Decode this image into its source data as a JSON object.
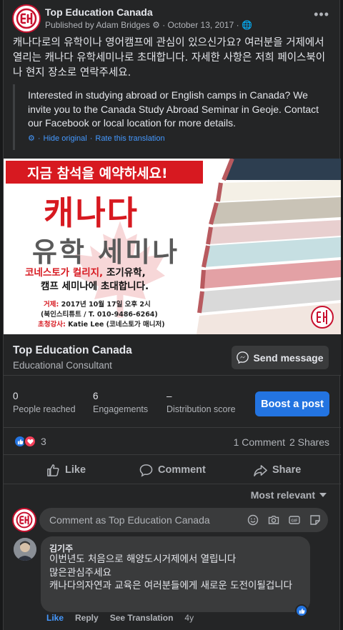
{
  "post": {
    "page_name": "Top Education Canada",
    "published_by": "Published by Adam Bridges",
    "date": "October 13, 2017",
    "more": "•••",
    "body_korean": "캐나다로의 유학이나 영어캠프에 관심이 있으신가요? 여러분을 거제에서 열리는 캐나다 유학세미나로 초대합니다. 자세한 사항은 저희 페이스북이나 현지 장소로 연락주세요.",
    "translation": "Interested in studying abroad or English camps in Canada? We invite you to the Canada Study Abroad Seminar in Geoje. Contact our Facebook or local location for more details.",
    "hide_original": "Hide original",
    "rate_translation": "Rate this translation"
  },
  "banner": {
    "reserve": "지금 참석을 예약하세요!",
    "title_line1": "캐나다",
    "title_line2": "유학 세미나",
    "invite_line1_red": "코네스토가 컬리지,",
    "invite_line1_rest": " 조기유학,",
    "invite_line2": "캠프 세미나에 초대합니다.",
    "place_label": "거제:",
    "place_value": " 2017년 10월 17일 오후 2시",
    "address": "(북인스티튜트 / T. 010-9486-6264)",
    "speaker_label": "초청강사:",
    "speaker_value": " Katie Lee (코네스토가 매니저)"
  },
  "page_info": {
    "name": "Top Education Canada",
    "category": "Educational Consultant",
    "send_message": "Send message"
  },
  "stats": {
    "reached_value": "0",
    "reached_label": "People reached",
    "engagements_value": "6",
    "engagements_label": "Engagements",
    "distribution_value": "–",
    "distribution_label": "Distribution score",
    "boost": "Boost a post"
  },
  "reactions": {
    "count": "3",
    "comments": "1 Comment",
    "shares": "2 Shares"
  },
  "actions": {
    "like": "Like",
    "comment": "Comment",
    "share": "Share"
  },
  "comments": {
    "sort": "Most relevant",
    "input_placeholder": "Comment as Top Education Canada",
    "items": [
      {
        "author": "김기주",
        "text": "이번년도 처음으로 해양도시거제에서 열립니다\n많은관심주세요\n캐나다의자연과 교육은 여러분들에게 새로운 도전이될겁니다",
        "like": "Like",
        "reply": "Reply",
        "see_translation": "See Translation",
        "age": "4y"
      }
    ]
  },
  "colors": {
    "accent": "#2374e1",
    "brand_red": "#d71920",
    "link": "#4599ff"
  }
}
